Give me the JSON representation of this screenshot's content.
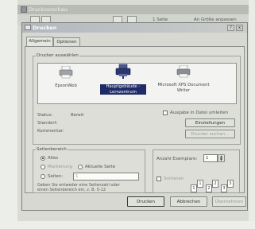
{
  "background_window": {
    "title": "Druckvorschau",
    "toolbar": {
      "page_field": "1 Seite",
      "zoom_field": "An Größe anpassen"
    }
  },
  "dialog": {
    "title": "Drucken",
    "title_buttons": {
      "help": "?",
      "close": "x"
    },
    "tabs": [
      {
        "label": "Allgemein",
        "active": true
      },
      {
        "label": "Optionen",
        "active": false
      }
    ],
    "printer_section": {
      "legend": "Drucker auswählen",
      "printers": [
        {
          "name": "EpsonWeb",
          "selected": false,
          "icon": "printer-icon"
        },
        {
          "name": "Hauptgebäude - Lernzentrum",
          "selected": true,
          "icon": "network-printer-icon"
        },
        {
          "name": "Microsoft XPS Document Writer",
          "selected": false,
          "icon": "printer-icon"
        }
      ],
      "status_label": "Status:",
      "status_value": "Bereit",
      "location_label": "Standort:",
      "comment_label": "Kommentar:",
      "print_to_file_label": "Ausgabe in Datei umleiten",
      "preferences_button": "Einstellungen",
      "find_printer_button": "Drucker suchen..."
    },
    "page_range": {
      "legend": "Seitenbereich",
      "all_label": "Alles",
      "selection_label": "Markierung",
      "current_page_label": "Aktuelle Seite",
      "pages_label": "Seiten:",
      "pages_value": "1",
      "help_text_1": "Geben Sie entweder eine Seitenzahl oder",
      "help_text_2": "einen Seitenbereich ein, z. B. 5-12"
    },
    "copies": {
      "count_label": "Anzahl Exemplare:",
      "count_value": "1",
      "collate_label": "Sortieren",
      "collate_icons": [
        "1",
        "1",
        "2",
        "2",
        "3",
        "3"
      ]
    },
    "buttons": {
      "print": "Drucken",
      "cancel": "Abbrechen",
      "apply": "Übernehmen"
    }
  }
}
